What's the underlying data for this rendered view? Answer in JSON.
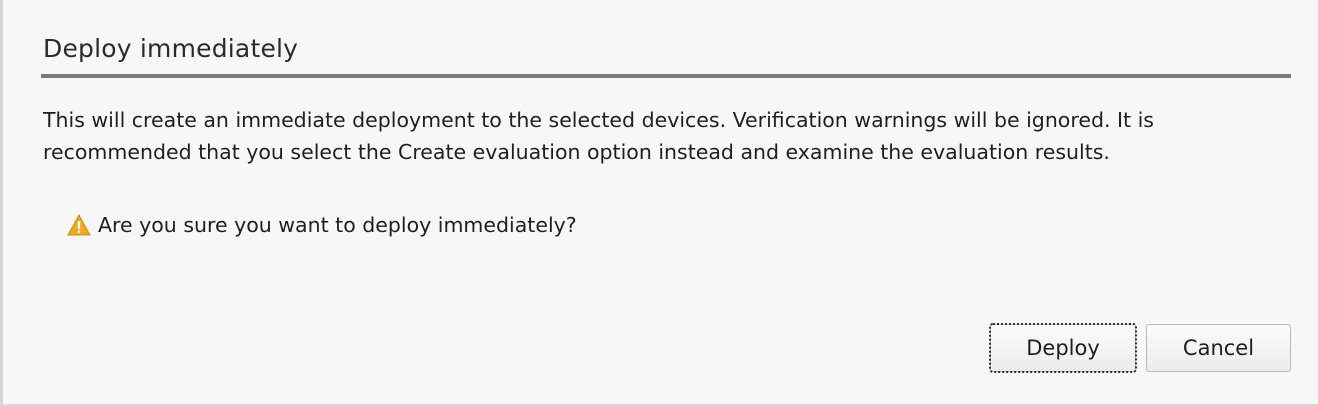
{
  "dialog": {
    "title": "Deploy immediately",
    "message": "This will create an immediate deployment to the selected devices. Verification warnings will be ignored. It is recommended that you select the Create evaluation option instead and examine the evaluation results.",
    "warning": {
      "icon": "warning-icon",
      "text": "Are you sure you want to deploy immediately?",
      "icon_color": "#f0a81e"
    },
    "buttons": {
      "deploy_label": "Deploy",
      "cancel_label": "Cancel"
    }
  }
}
